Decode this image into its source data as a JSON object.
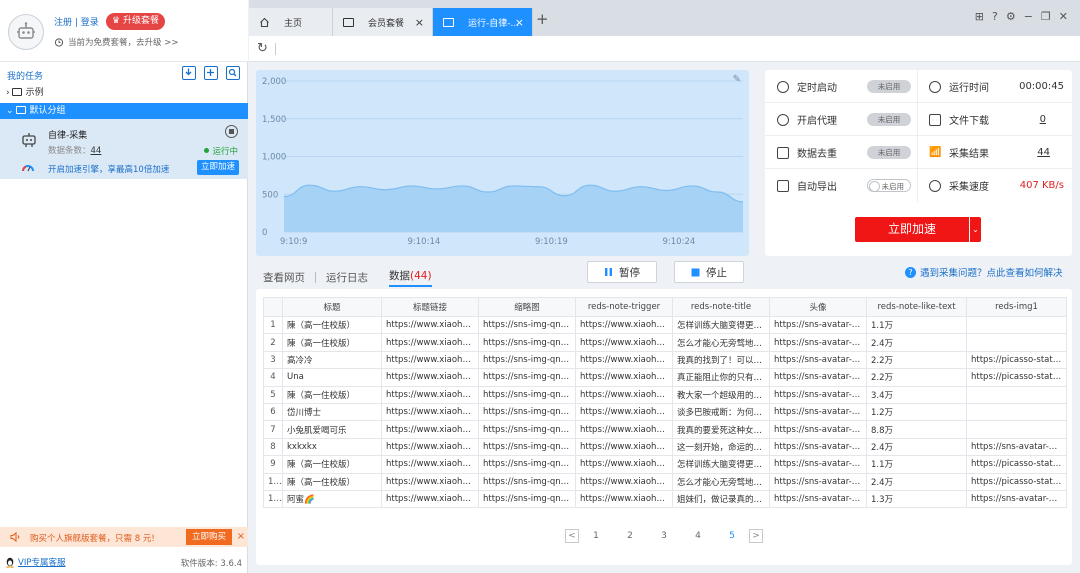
{
  "user": {
    "links": "注册 | 登录",
    "upgrade_label": "升级套餐",
    "subtitle": "当前为免费套餐，去升级 >>"
  },
  "tasks": {
    "title": "我的任务",
    "tree": [
      {
        "label": "示例",
        "expanded": false
      },
      {
        "label": "默认分组",
        "expanded": true
      }
    ],
    "task": {
      "name": "自律-采集",
      "count_label": "数据条数：",
      "count": "44",
      "status": "运行中",
      "accel_tip": "开启加速引擎，享最高10倍加速",
      "accel_button": "立即加速"
    }
  },
  "promo": {
    "text": "购买个人旗舰版套餐，只需 8 元!",
    "button": "立即购买",
    "close": "×"
  },
  "footer": {
    "vip": "VIP专属客服",
    "version": "软件版本: 3.6.4"
  },
  "tabs": [
    {
      "label": "主页",
      "icon": "home-icon",
      "active": false,
      "closable": false
    },
    {
      "label": "会员套餐",
      "icon": "page-icon",
      "active": false,
      "closable": true
    },
    {
      "label": "运行-自律-...",
      "icon": "page-icon",
      "active": true,
      "closable": true
    }
  ],
  "tab_close": "×",
  "tab_add": "+",
  "chart": {
    "y_ticks": [
      "2,000",
      "1,500",
      "1,000",
      "500",
      "0"
    ],
    "x_ticks": [
      "9:10:9",
      "9:10:14",
      "9:10:19",
      "9:10:24"
    ],
    "fill": "#a6d2f6",
    "stroke": "#7fbdf0",
    "background": "#cfe6fb"
  },
  "chart_data": {
    "type": "area",
    "title": "",
    "xlabel": "",
    "ylabel": "",
    "ylim": [
      0,
      2000
    ],
    "x": [
      "9:10:9",
      "9:10:10",
      "9:10:11",
      "9:10:12",
      "9:10:13",
      "9:10:14",
      "9:10:15",
      "9:10:16",
      "9:10:17",
      "9:10:18",
      "9:10:19",
      "9:10:20",
      "9:10:21",
      "9:10:22",
      "9:10:23",
      "9:10:24",
      "9:10:25",
      "9:10:26",
      "9:10:27"
    ],
    "values": [
      470,
      620,
      540,
      600,
      560,
      610,
      570,
      610,
      530,
      610,
      600,
      480,
      620,
      540,
      600,
      550,
      610,
      530,
      400
    ],
    "grid": true
  },
  "status": {
    "rows": [
      {
        "left_label": "定时启动",
        "left_icon": "clock-icon",
        "left_pill": "未启用",
        "right_label": "运行时间",
        "right_icon": "timer-icon",
        "right_value": "00:00:45"
      },
      {
        "left_label": "开启代理",
        "left_icon": "globe-icon",
        "left_pill": "未启用",
        "right_label": "文件下载",
        "right_icon": "file-download-icon",
        "right_value": "0"
      },
      {
        "left_label": "数据去重",
        "left_icon": "dedupe-icon",
        "left_pill": "未启用",
        "right_label": "采集结果",
        "right_icon": "chart-icon",
        "right_value": "44"
      },
      {
        "left_label": "自动导出",
        "left_icon": "export-icon",
        "left_pill": "未启用",
        "right_label": "采集速度",
        "right_icon": "speed-icon",
        "right_value": "407 KB/s"
      }
    ],
    "speed_button": "立即加速",
    "accent": "#f01616"
  },
  "subtabs": {
    "web": "查看网页",
    "log": "运行日志",
    "data": "数据",
    "data_count": "(44)"
  },
  "controls": {
    "pause": "暂停",
    "stop": "停止"
  },
  "help": {
    "q": "?",
    "text": "遇到采集问题？点此查看如何解决"
  },
  "table": {
    "headers": [
      "",
      "标题",
      "标题链接",
      "缩略图",
      "reds-note-trigger",
      "reds-note-title",
      "头像",
      "reds-note-like-text",
      "reds-img1"
    ],
    "rows": [
      [
        "1",
        "陳（高一住校版）",
        "https://www.xiaohongs...",
        "https://sns-img-qn.xhsc...",
        "https://www.xiaohongsh...",
        "怎样训练大脑变得更聪...",
        "https://sns-avatar-qc.xh...",
        "1.1万",
        ""
      ],
      [
        "2",
        "陳（高一住校版）",
        "https://www.xiaohongs...",
        "https://sns-img-qn.xhsc...",
        "https://www.xiaohongsh...",
        "怎么才能心无旁骛地学...",
        "https://sns-avatar-qc.xh...",
        "2.4万",
        ""
      ],
      [
        "3",
        "高冷冷",
        "https://www.xiaohongs...",
        "https://sns-img-qn.xhsc...",
        "https://www.xiaohongsh...",
        "我真的找到了！可以10...",
        "https://sns-avatar-qc.xh...",
        "2.2万",
        "https://picasso-static.xi..."
      ],
      [
        "4",
        "Una",
        "https://www.xiaohongs...",
        "https://sns-img-qn.xhsc...",
        "https://www.xiaohongsh...",
        "真正能阻止你的只有你...",
        "https://sns-avatar-qc.xh...",
        "2.2万",
        "https://picasso-static.xi..."
      ],
      [
        "5",
        "陳（高一住校版）",
        "https://www.xiaohongs...",
        "https://sns-img-qn.xhsc...",
        "https://www.xiaohongsh...",
        "教大家一个超级用的学...",
        "https://sns-avatar-qc.xh...",
        "3.4万",
        ""
      ],
      [
        "6",
        "岱川博士",
        "https://www.xiaohongs...",
        "https://sns-img-qn.xhsc...",
        "https://www.xiaohongsh...",
        "谈多巴胺戒断：为何有...",
        "https://sns-avatar-qc.xh...",
        "1.2万",
        ""
      ],
      [
        "7",
        "小兔肌爱喝可乐",
        "https://www.xiaohongs...",
        "https://sns-img-qn.xhsc...",
        "https://www.xiaohongsh...",
        "我真的要爱死这种女生...",
        "https://sns-avatar-qc.xh...",
        "8.8万",
        ""
      ],
      [
        "8",
        "kxkxkx",
        "https://www.xiaohongs...",
        "https://sns-img-qn.xhsc...",
        "https://www.xiaohongsh...",
        "这一刻开始，命运的齿...",
        "https://sns-avatar-qc.xh...",
        "2.4万",
        "https://sns-avatar-qc.xh..."
      ],
      [
        "9",
        "陳（高一住校版）",
        "https://www.xiaohongs...",
        "https://sns-img-qn.xhsc...",
        "https://www.xiaohongsh...",
        "怎样训练大脑变得更聪...",
        "https://sns-avatar-qc.xh...",
        "1.1万",
        "https://picasso-static.xi..."
      ],
      [
        "10",
        "陳（高一住校版）",
        "https://www.xiaohongs...",
        "https://sns-img-qn.xhsc...",
        "https://www.xiaohongsh...",
        "怎么才能心无旁骛地学...",
        "https://sns-avatar-qc.xh...",
        "2.4万",
        "https://picasso-static.xi..."
      ],
      [
        "11",
        "阿蜜🌈",
        "https://www.xiaohongs...",
        "https://sns-img-qn.xhsc...",
        "https://www.xiaohongsh...",
        "姐妹们，做记录真的可...",
        "https://sns-avatar-qc.xh...",
        "1.3万",
        "https://sns-avatar-qc.xh..."
      ]
    ]
  },
  "pager": {
    "prev": "<",
    "next": ">",
    "pages": [
      "1",
      "2",
      "3",
      "4",
      "5"
    ],
    "current": "5"
  },
  "colors": {
    "primary": "#1e90ff",
    "danger": "#e64545",
    "success": "#22a33a"
  }
}
